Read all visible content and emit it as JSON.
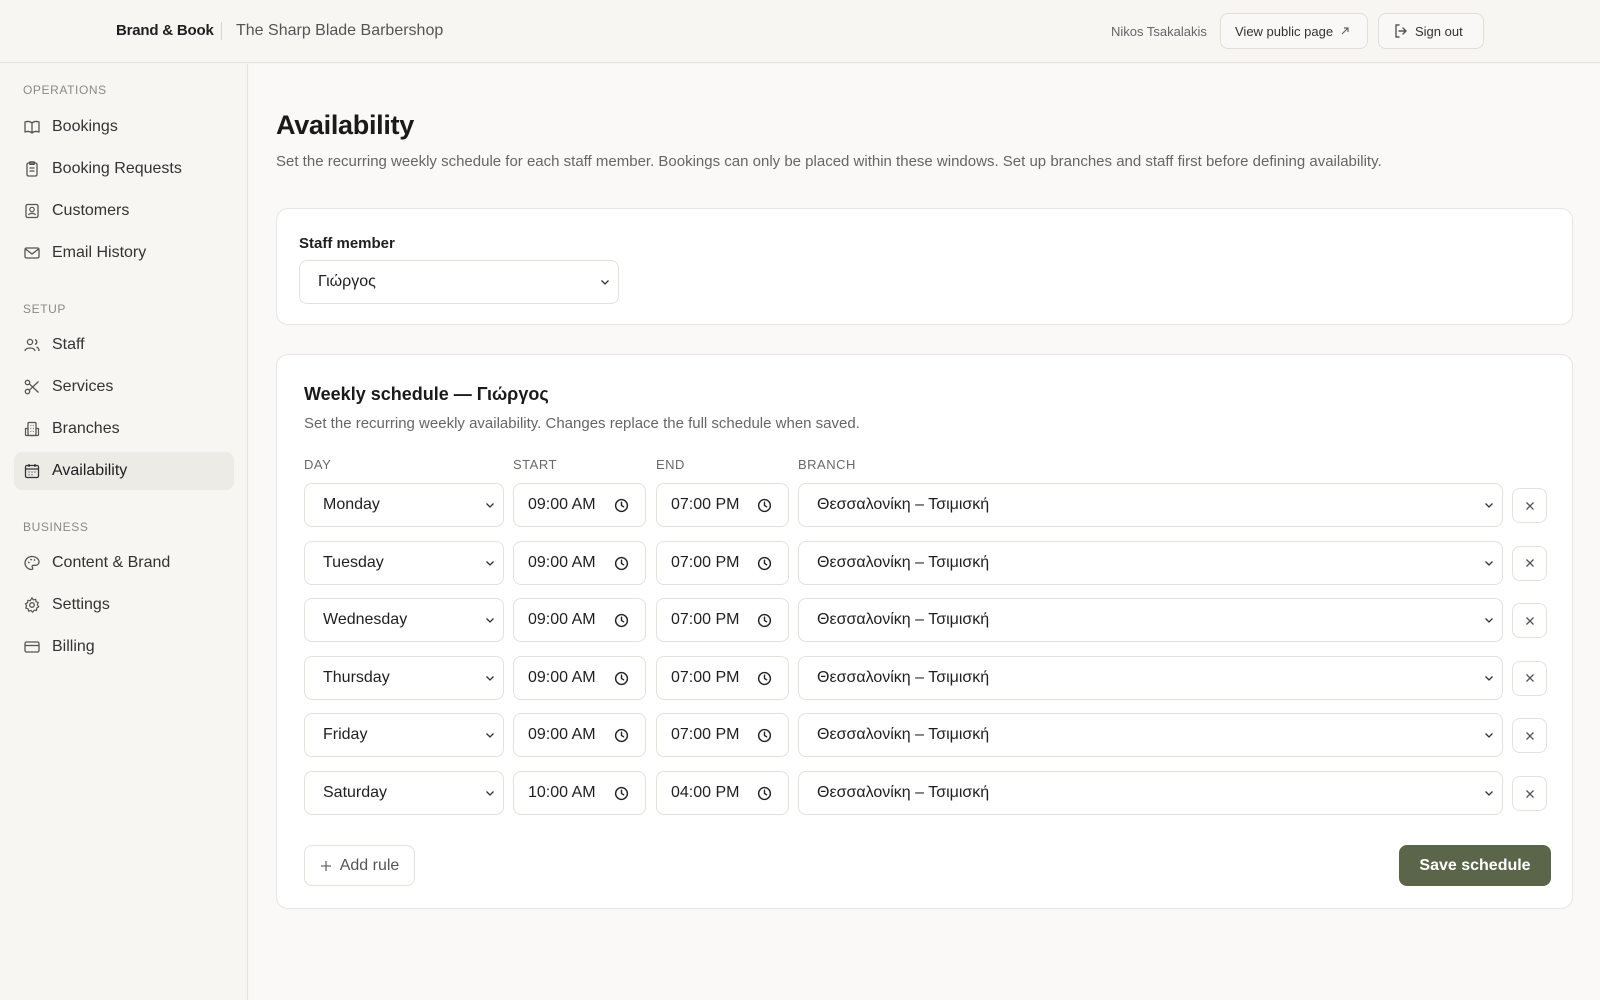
{
  "header": {
    "brand": "Brand & Book",
    "shop_name": "The Sharp Blade Barbershop",
    "user_name": "Nikos Tsakalakis",
    "view_public_label": "View public page",
    "sign_out_label": "Sign out"
  },
  "sidebar": {
    "sections": [
      {
        "label": "OPERATIONS",
        "items": [
          {
            "label": "Bookings",
            "icon": "book-open-icon"
          },
          {
            "label": "Booking Requests",
            "icon": "clipboard-icon"
          },
          {
            "label": "Customers",
            "icon": "contact-icon"
          },
          {
            "label": "Email History",
            "icon": "mail-icon"
          }
        ]
      },
      {
        "label": "SETUP",
        "items": [
          {
            "label": "Staff",
            "icon": "users-icon"
          },
          {
            "label": "Services",
            "icon": "scissors-icon"
          },
          {
            "label": "Branches",
            "icon": "building-icon"
          },
          {
            "label": "Availability",
            "icon": "calendar-icon",
            "active": true
          }
        ]
      },
      {
        "label": "BUSINESS",
        "items": [
          {
            "label": "Content & Brand",
            "icon": "palette-icon"
          },
          {
            "label": "Settings",
            "icon": "gear-icon"
          },
          {
            "label": "Billing",
            "icon": "credit-card-icon"
          }
        ]
      }
    ]
  },
  "page": {
    "title": "Availability",
    "description": "Set the recurring weekly schedule for each staff member. Bookings can only be placed within these windows. Set up branches and staff first before defining availability."
  },
  "staff_picker": {
    "label": "Staff member",
    "selected": "Γιώργος"
  },
  "schedule": {
    "title": "Weekly schedule — Γιώργος",
    "description": "Set the recurring weekly availability. Changes replace the full schedule when saved.",
    "columns": {
      "day": "DAY",
      "start": "START",
      "end": "END",
      "branch": "BRANCH"
    },
    "rows": [
      {
        "day": "Monday",
        "start": "09:00 AM",
        "end": "07:00 PM",
        "branch": "Θεσσαλονίκη – Τσιμισκή"
      },
      {
        "day": "Tuesday",
        "start": "09:00 AM",
        "end": "07:00 PM",
        "branch": "Θεσσαλονίκη – Τσιμισκή"
      },
      {
        "day": "Wednesday",
        "start": "09:00 AM",
        "end": "07:00 PM",
        "branch": "Θεσσαλονίκη – Τσιμισκή"
      },
      {
        "day": "Thursday",
        "start": "09:00 AM",
        "end": "07:00 PM",
        "branch": "Θεσσαλονίκη – Τσιμισκή"
      },
      {
        "day": "Friday",
        "start": "09:00 AM",
        "end": "07:00 PM",
        "branch": "Θεσσαλονίκη – Τσιμισκή"
      },
      {
        "day": "Saturday",
        "start": "10:00 AM",
        "end": "04:00 PM",
        "branch": "Θεσσαλονίκη – Τσιμισκή"
      }
    ],
    "add_rule_label": "Add rule",
    "save_label": "Save schedule"
  },
  "colors": {
    "accent": "#5a6549",
    "background": "#faf9f7",
    "sidebar_active": "#ecebe6"
  }
}
